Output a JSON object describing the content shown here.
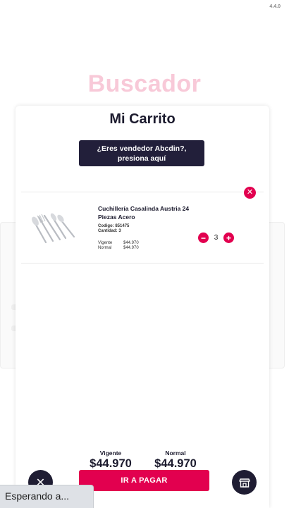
{
  "app": {
    "version": "4.4.0",
    "background_title": "Buscador"
  },
  "cart": {
    "title": "Mi Carrito",
    "seller_prompt": "¿Eres vendedor Abcdin?, presiona aquí",
    "remove_icon": "close-icon",
    "item": {
      "name": "Cuchillería Casalinda Austria 24 Piezas Acero",
      "code_label": "Codigo:",
      "code_value": "851475",
      "qty_label": "Cantidad:",
      "qty_value": "3",
      "current_label": "Vigente",
      "current_price": "$44.970",
      "normal_label": "Normal",
      "normal_price": "$44.970",
      "quantity": "3",
      "image": "cutlery-set"
    },
    "totals": {
      "current_label": "Vigente",
      "current_value": "$44.970",
      "normal_label": "Normal",
      "normal_value": "$44.970"
    },
    "pay_button": "IR A PAGAR"
  },
  "fabs": {
    "close_icon": "close-icon",
    "store_icon": "store-icon"
  },
  "browser": {
    "status_text": "Esperando a..."
  },
  "colors": {
    "accent": "#e2004f",
    "dark": "#221f3a",
    "background_title": "#f8c9d8"
  }
}
